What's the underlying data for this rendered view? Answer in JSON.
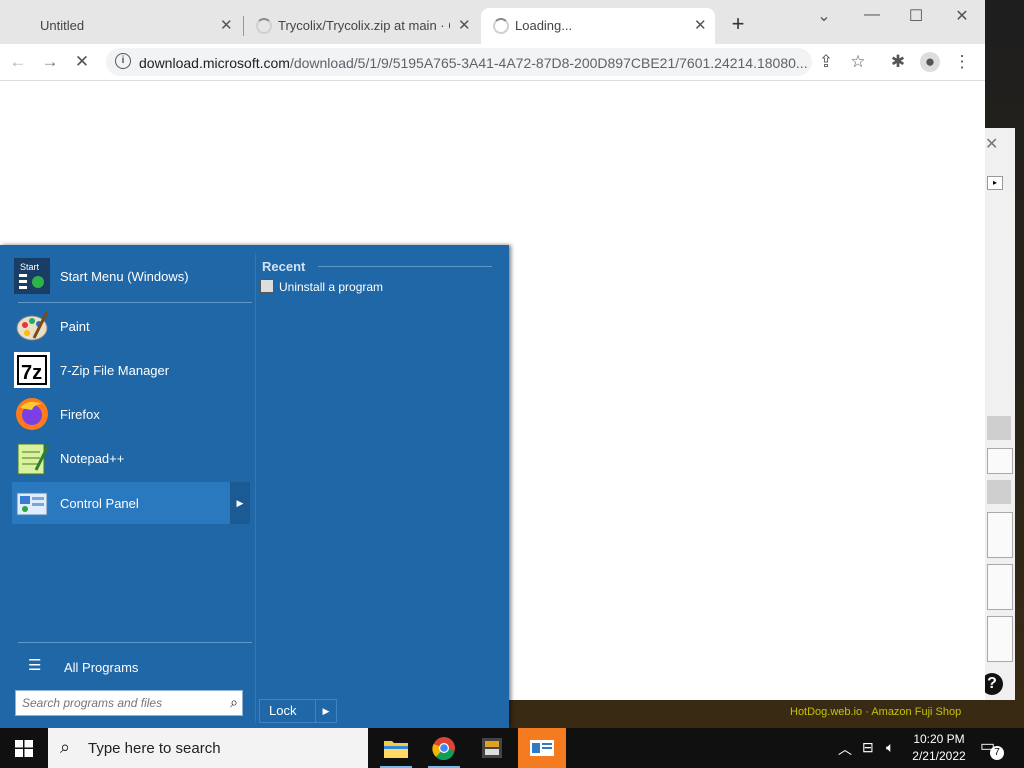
{
  "browser": {
    "tabs": [
      {
        "label": "Untitled",
        "state": "idle"
      },
      {
        "label": "Trycolix/Trycolix.zip at main · Git",
        "state": "loading"
      },
      {
        "label": "Loading...",
        "state": "loading",
        "active": true
      }
    ],
    "new_tab_label": "+",
    "url_host": "download.microsoft.com",
    "url_path": "/download/5/1/9/5195A765-3A41-4A72-87D8-200D897CBE21/7601.24214.18080..."
  },
  "start_menu": {
    "pinned": [
      {
        "label": "Start Menu (Windows)",
        "icon": "start-menu-icon"
      },
      {
        "label": "Paint",
        "icon": "paint-icon"
      },
      {
        "label": "7-Zip File Manager",
        "icon": "7zip-icon"
      },
      {
        "label": "Firefox",
        "icon": "firefox-icon"
      },
      {
        "label": "Notepad++",
        "icon": "notepadpp-icon"
      },
      {
        "label": "Control Panel",
        "icon": "control-panel-icon"
      }
    ],
    "all_programs_label": "All Programs",
    "search_placeholder": "Search programs and files",
    "recent_label": "Recent",
    "recent_items": [
      "Uninstall a program"
    ],
    "lock_label": "Lock"
  },
  "taskbar": {
    "search_placeholder": "Type here to search",
    "time": "10:20 PM",
    "date": "2/21/2022",
    "notification_count": "7"
  },
  "background": {
    "yellow_text": "HotDog.web.io · Amazon Fuji Shop"
  },
  "colors": {
    "start_menu_bg": "#1f67a6",
    "taskbar_bg": "#101010",
    "accent": "#76b9ed"
  }
}
